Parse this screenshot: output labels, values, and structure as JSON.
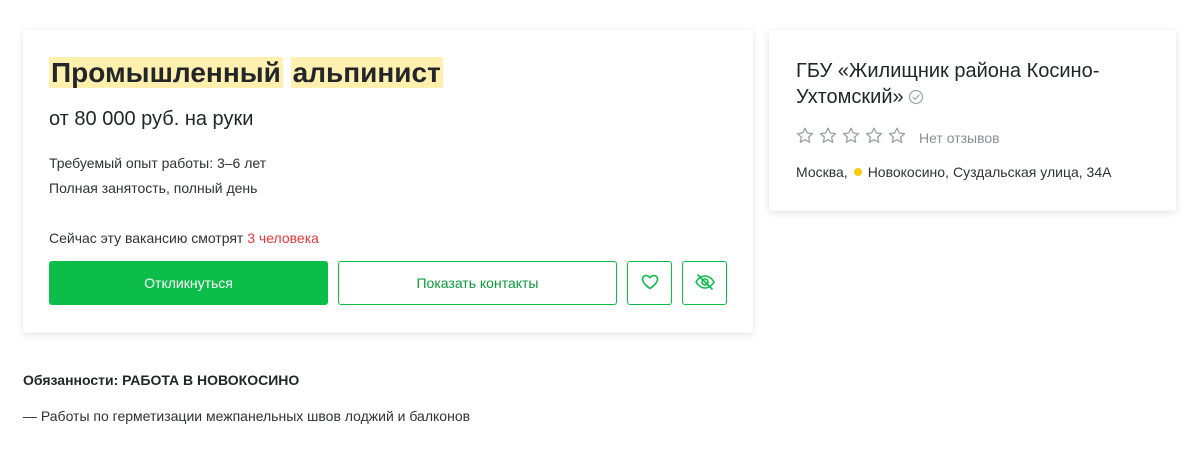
{
  "vacancy": {
    "title_word1": "Промышленный",
    "title_word2": "альпинист",
    "salary": "от 80 000 руб. на руки",
    "experience": "Требуемый опыт работы: 3–6 лет",
    "employment": "Полная занятость, полный день",
    "watching_prefix": "Сейчас эту вакансию смотрят",
    "watching_count": "3 человека",
    "apply_label": "Откликнуться",
    "contacts_label": "Показать контакты",
    "favorite_icon": "heart-icon",
    "hide_icon": "eye-crossed-icon"
  },
  "employer": {
    "name": "ГБУ «Жилищник района Косино-Ухтомский»",
    "verified_icon": "check-circle-icon",
    "reviews_label": "Нет отзывов",
    "stars_filled": 0,
    "stars_total": 5,
    "city": "Москва,",
    "metro": "Новокосино,",
    "street": "Суздальская улица, 34А"
  },
  "description": {
    "heading": "Обязанности: РАБОТА В НОВОКОСИНО",
    "line1": "— Работы по герметизации межпанельных швов лоджий и балконов"
  },
  "colors": {
    "accent_green": "#0dbd4a",
    "highlight": "#fff0b0",
    "watching_red": "#e4393c",
    "metro_yellow": "#ffcb0f"
  }
}
